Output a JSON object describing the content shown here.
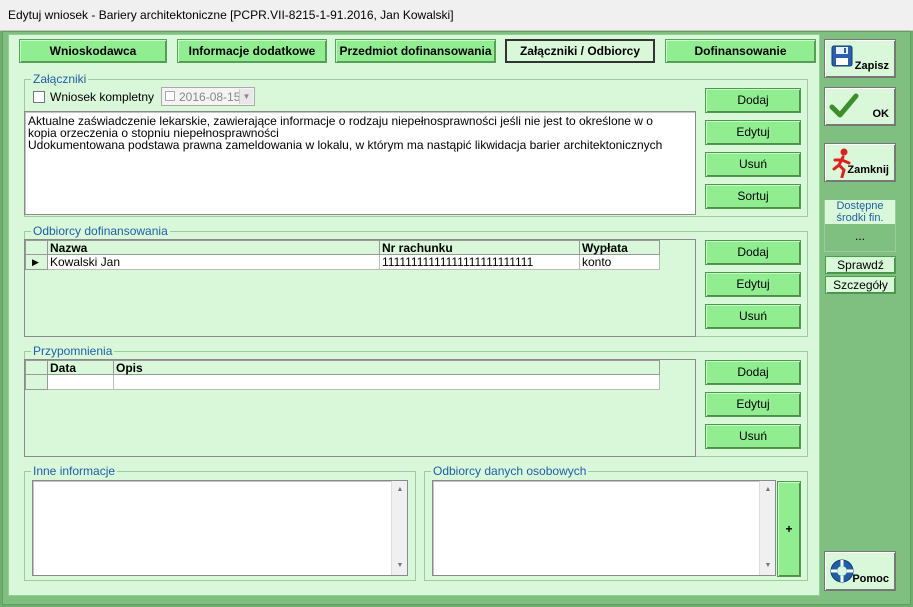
{
  "window": {
    "title": "Edytuj wniosek - Bariery architektoniczne  [PCPR.VII-8215-1-91.2016, Jan Kowalski]"
  },
  "tabs": [
    {
      "label": "Wnioskodawca"
    },
    {
      "label": "Informacje dodatkowe"
    },
    {
      "label": "Przedmiot dofinansowania"
    },
    {
      "label": "Załączniki / Odbiorcy"
    },
    {
      "label": "Dofinansowanie"
    }
  ],
  "attachments": {
    "label": "Załączniki",
    "complete_label": "Wniosek kompletny",
    "complete_checked": false,
    "date_value": "2016-08-15",
    "lines": [
      "Aktualne zaświadczenie lekarskie, zawierające informacje o rodzaju niepełnosprawności jeśli nie jest to określone w o",
      "kopia orzeczenia o stopniu niepełnosprawności",
      "Udokumentowana podstawa prawna zameldowania w lokalu, w którym ma nastąpić likwidacja barier architektonicznych"
    ],
    "buttons": {
      "add": "Dodaj",
      "edit": "Edytuj",
      "delete": "Usuń",
      "sort": "Sortuj"
    }
  },
  "recipients": {
    "label": "Odbiorcy dofinansowania",
    "columns": [
      "Nazwa",
      "Nr rachunku",
      "Wypłata"
    ],
    "rows": [
      {
        "name": "Kowalski Jan",
        "account": "11111111111111111111111111",
        "payout": "konto"
      }
    ],
    "buttons": {
      "add": "Dodaj",
      "edit": "Edytuj",
      "delete": "Usuń"
    }
  },
  "reminders": {
    "label": "Przypomnienia",
    "columns": [
      "Data",
      "Opis"
    ],
    "buttons": {
      "add": "Dodaj",
      "edit": "Edytuj",
      "delete": "Usuń"
    }
  },
  "other_info": {
    "label": "Inne informacje"
  },
  "data_recipients": {
    "label": "Odbiorcy danych osobowych",
    "plus_label": "+"
  },
  "side": {
    "save": "Zapisz",
    "ok": "OK",
    "close": "Zamknij",
    "funds_label_line1": "Dostępne",
    "funds_label_line2": "środki fin.",
    "funds_value": "...",
    "check": "Sprawdź",
    "details": "Szczegóły",
    "help": "Pomoc"
  },
  "colors": {
    "tab_green": "#90ee90",
    "panel": "#d9f7d9",
    "frame": "#7fbf7f",
    "group_label": "#1f5fa8"
  }
}
